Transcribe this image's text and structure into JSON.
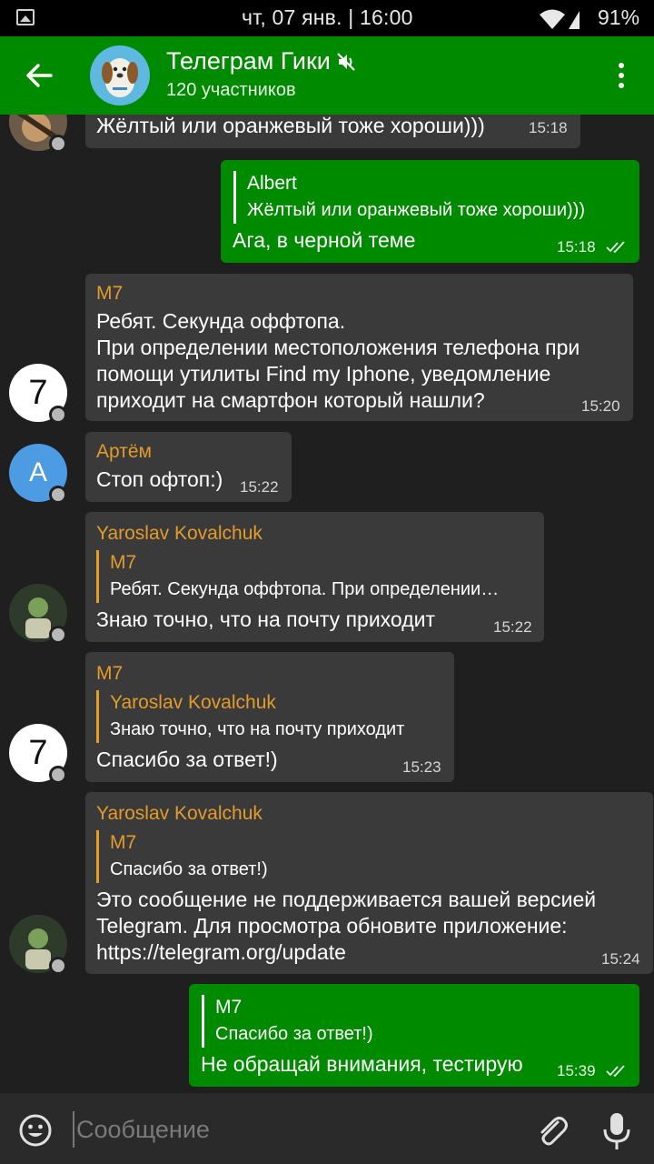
{
  "status_bar": {
    "datetime": "чт, 07 янв. | 16:00",
    "battery": "91%",
    "icons": [
      "image-icon",
      "wifi-icon",
      "signal-icon"
    ]
  },
  "header": {
    "title": "Телеграм Гики",
    "subtitle": "120 участников",
    "icons": [
      "back-arrow-icon",
      "dog-avatar-icon",
      "mute-icon",
      "more-vert-icon"
    ]
  },
  "colors": {
    "header": "#008a00",
    "outgoing_bubble": "#008a00",
    "incoming_bubble": "#3a3a3a",
    "background": "#1f1f1f",
    "sender_name": "#e39b2b"
  },
  "messages": [
    {
      "dir": "in",
      "text": "Жёлтый или оранжевый тоже хороши)))",
      "time": "15:18"
    },
    {
      "dir": "out",
      "reply_name": "Albert",
      "reply_text": "Жёлтый или оранжевый тоже хороши)))",
      "text": "Ага, в черной теме",
      "time": "15:18"
    },
    {
      "dir": "in",
      "avatar": "7",
      "sender": "M7",
      "lines": [
        "Ребят. Секунда оффтопа.",
        "При определении местоположения телефона при",
        "помощи утилиты Find my Iphone, уведомление",
        "приходит на смартфон который нашли?"
      ],
      "time": "15:20"
    },
    {
      "dir": "in",
      "avatar": "A",
      "sender": "Артём",
      "text": "Стоп офтоп:)",
      "time": "15:22"
    },
    {
      "dir": "in",
      "sender": "Yaroslav Kovalchuk",
      "reply_name": "M7",
      "reply_text": "Ребят. Секунда оффтопа. При определении…",
      "text": "Знаю точно, что на почту приходит",
      "time": "15:22"
    },
    {
      "dir": "in",
      "avatar": "7",
      "sender": "M7",
      "reply_name": "Yaroslav Kovalchuk",
      "reply_text": "Знаю точно, что на почту приходит",
      "text": "Спасибо за ответ!)",
      "time": "15:23"
    },
    {
      "dir": "in",
      "sender": "Yaroslav Kovalchuk",
      "reply_name": "M7",
      "reply_text": "Спасибо за ответ!)",
      "lines": [
        "Это сообщение не поддерживается вашей версией",
        "Telegram. Для просмотра обновите приложение:",
        "https://telegram.org/update"
      ],
      "time": "15:24"
    },
    {
      "dir": "out",
      "reply_name": "M7",
      "reply_text": "Спасибо за ответ!)",
      "text": "Не обращай внимания, тестирую",
      "time": "15:39"
    }
  ],
  "input": {
    "placeholder": "Сообщение",
    "icons": [
      "emoji-icon",
      "paperclip-icon",
      "microphone-icon"
    ]
  }
}
